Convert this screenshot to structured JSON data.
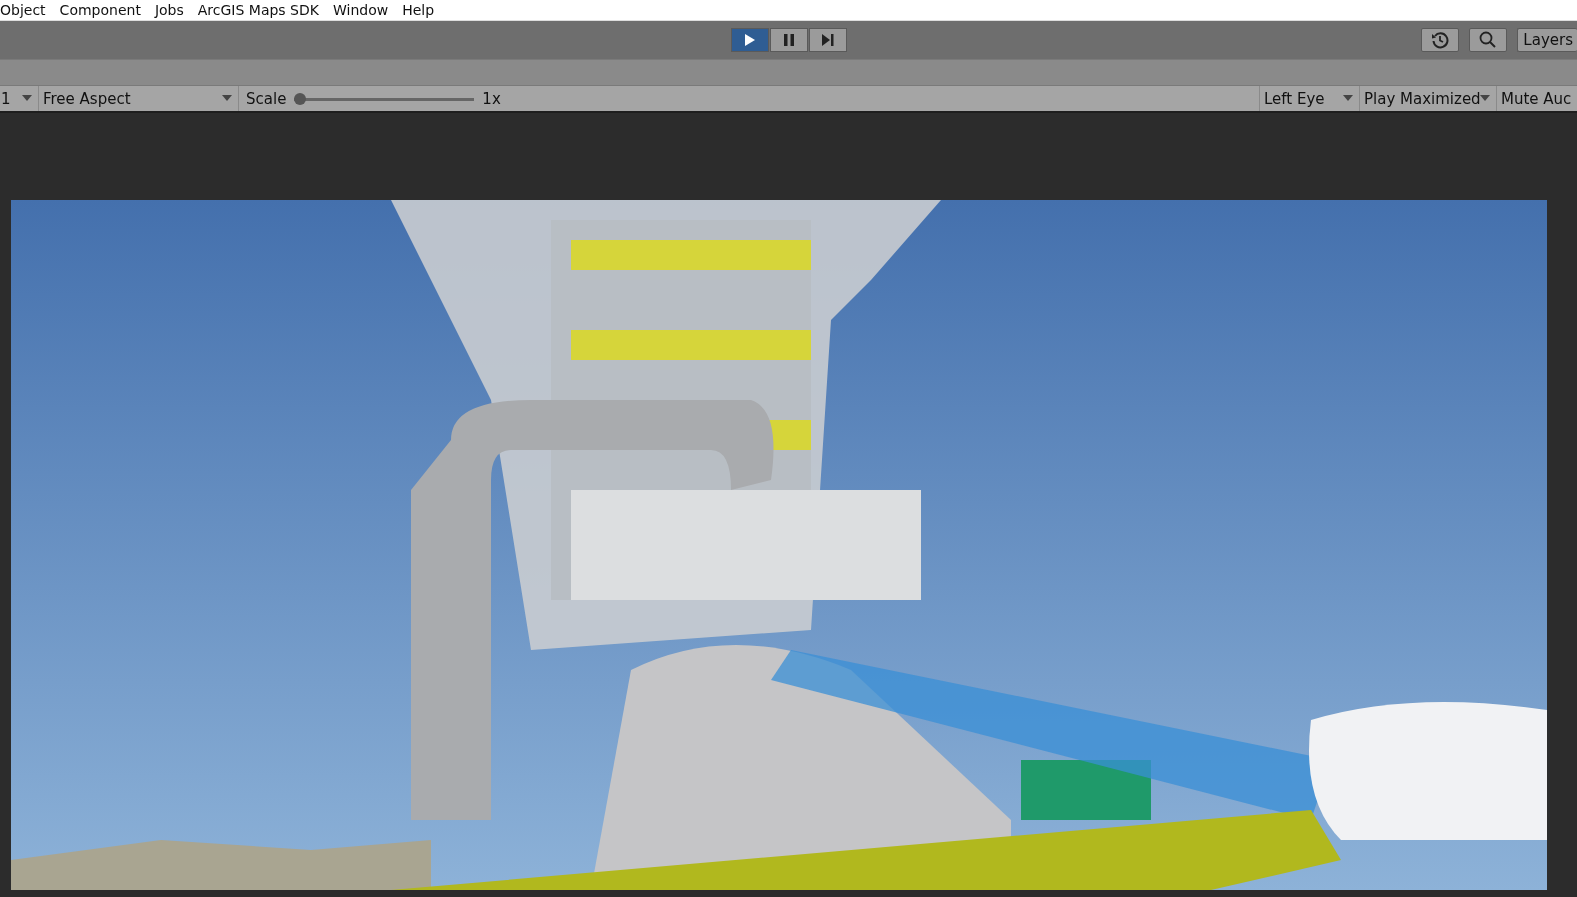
{
  "menu": [
    "Object",
    "Component",
    "Jobs",
    "ArcGIS Maps SDK",
    "Window",
    "Help"
  ],
  "play_controls": [
    {
      "kind": "play",
      "on": true
    },
    {
      "kind": "pause",
      "on": false
    },
    {
      "kind": "step",
      "on": false
    }
  ],
  "toolbar_right": [
    {
      "kind": "history"
    },
    {
      "kind": "search"
    },
    {
      "kind": "layers",
      "label": "Layers"
    }
  ],
  "game_toolbar": {
    "display": "1",
    "aspect": "Free Aspect",
    "scale_label": "Scale",
    "scale": {
      "level": 0.0
    },
    "scale_reading": "1x",
    "eye": "Left Eye",
    "play_mode": "Play Maximized",
    "mute": "Mute Auc"
  }
}
